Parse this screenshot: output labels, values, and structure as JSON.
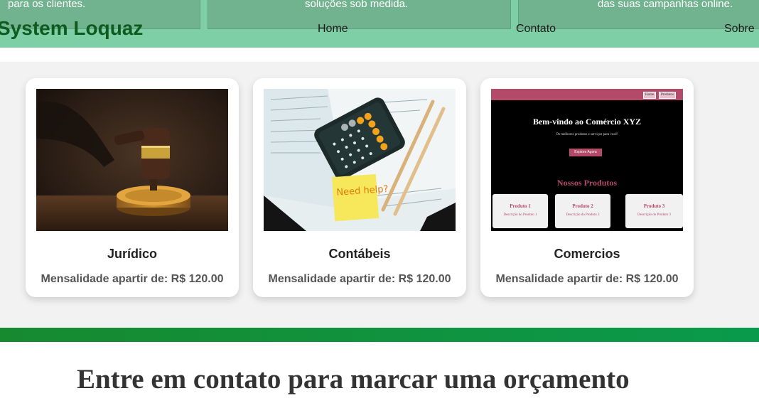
{
  "header": {
    "brand": "System Loquaz",
    "banner_texts": [
      "para os clientes.",
      "soluções sob medida.",
      "das suas campanhas online."
    ],
    "nav": [
      "Home",
      "Contato",
      "Sobre"
    ]
  },
  "services": [
    {
      "title": "Jurídico",
      "price": "Mensalidade apartir de: R$ 120.00",
      "image": "gavel-photo"
    },
    {
      "title": "Contábeis",
      "price": "Mensalidade apartir de: R$ 120.00",
      "image": "calculator-photo"
    },
    {
      "title": "Comercios",
      "price": "Mensalidade apartir de: R$ 120.00",
      "image": "ecommerce-site-preview"
    }
  ],
  "shop_preview": {
    "nav": [
      "Home",
      "Produtos"
    ],
    "headline": "Bem-vindo ao Comércio XYZ",
    "tagline": "Os melhores produtos e serviços para você!",
    "cta": "Explore Agora",
    "section": "Nossos Produtos",
    "products": [
      {
        "name": "Produto 1",
        "desc": "Descrição do Produto 1"
      },
      {
        "name": "Produto 2",
        "desc": "Descrição do Produto 2"
      },
      {
        "name": "Produto 3",
        "desc": "Descrição do Produto 3"
      }
    ]
  },
  "calculator_note": "Need help?",
  "contact": {
    "title": "Entre em contato para marcar uma orçamento"
  },
  "colors": {
    "header": "#7fcfa6",
    "brand": "#0e5a1f",
    "green_bar": "#178a2f",
    "shop_accent": "#b34a6a"
  }
}
